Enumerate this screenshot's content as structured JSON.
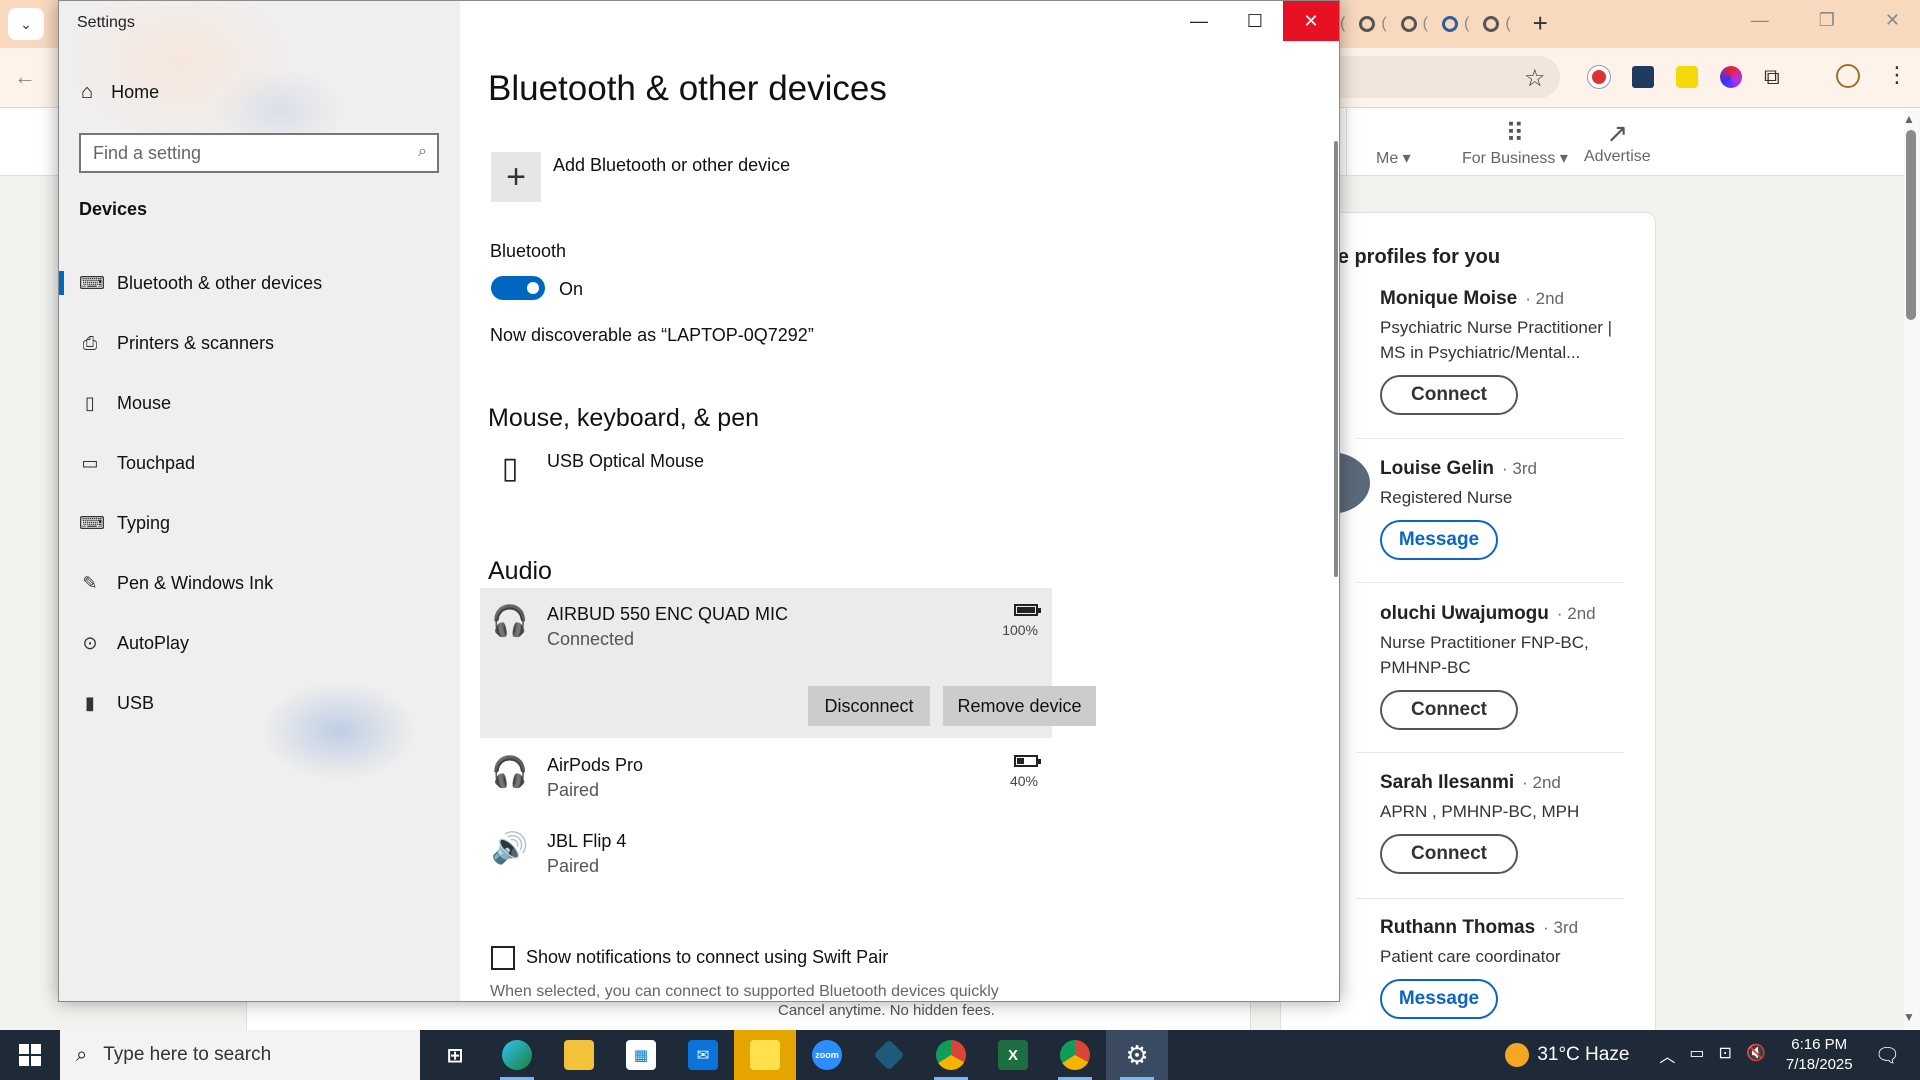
{
  "settings": {
    "window_title": "Settings",
    "home_label": "Home",
    "search_placeholder": "Find a setting",
    "group_label": "Devices",
    "nav": [
      {
        "label": "Bluetooth & other devices",
        "icon": "bluetooth-devices-icon"
      },
      {
        "label": "Printers & scanners",
        "icon": "printer-icon"
      },
      {
        "label": "Mouse",
        "icon": "mouse-icon"
      },
      {
        "label": "Touchpad",
        "icon": "touchpad-icon"
      },
      {
        "label": "Typing",
        "icon": "keyboard-icon"
      },
      {
        "label": "Pen & Windows Ink",
        "icon": "pen-icon"
      },
      {
        "label": "AutoPlay",
        "icon": "autoplay-icon"
      },
      {
        "label": "USB",
        "icon": "usb-icon"
      }
    ],
    "page_title": "Bluetooth & other devices",
    "add_device_label": "Add Bluetooth or other device",
    "bluetooth_label": "Bluetooth",
    "bluetooth_state": "On",
    "discoverable_text": "Now discoverable as “LAPTOP-0Q7292”",
    "mouse_section": "Mouse, keyboard, & pen",
    "mouse_device": "USB Optical Mouse",
    "audio_section": "Audio",
    "audio_devices": [
      {
        "name": "AIRBUD 550 ENC QUAD MIC",
        "status": "Connected",
        "battery": "100%",
        "battery_level": 1.0
      },
      {
        "name": "AirPods Pro",
        "status": "Paired",
        "battery": "40%",
        "battery_level": 0.4
      },
      {
        "name": "JBL Flip 4",
        "status": "Paired"
      }
    ],
    "disconnect_label": "Disconnect",
    "remove_label": "Remove device",
    "swift_pair_label": "Show notifications to connect using Swift Pair",
    "swift_pair_desc": "When selected, you can connect to supported Bluetooth devices quickly",
    "accent_color": "#0067c0",
    "close_color": "#e81123"
  },
  "browser": {
    "nav_me": "Me",
    "nav_business": "For Business",
    "nav_advertise": "Advertise",
    "card_title": "re profiles for you",
    "people": [
      {
        "name": "Monique Moise",
        "degree": "· 2nd",
        "title": "Psychiatric Nurse Practitioner | MS in Psychiatric/Mental...",
        "button": "Connect"
      },
      {
        "name": "Louise Gelin",
        "degree": "· 3rd",
        "title": "Registered Nurse",
        "button": "Message"
      },
      {
        "name": "oluchi Uwajumogu",
        "degree": "· 2nd",
        "title": "Nurse Practitioner FNP-BC, PMHNP-BC",
        "button": "Connect"
      },
      {
        "name": "Sarah Ilesanmi",
        "degree": "· 2nd",
        "title": "APRN , PMHNP-BC, MPH",
        "button": "Connect"
      },
      {
        "name": "Ruthann Thomas",
        "degree": "· 3rd",
        "title": "Patient care coordinator",
        "button": "Message"
      }
    ],
    "footer_text": "Cancel anytime. No hidden fees."
  },
  "taskbar": {
    "search_placeholder": "Type here to search",
    "weather": "31°C  Haze",
    "time": "6:16 PM",
    "date": "7/18/2025"
  }
}
